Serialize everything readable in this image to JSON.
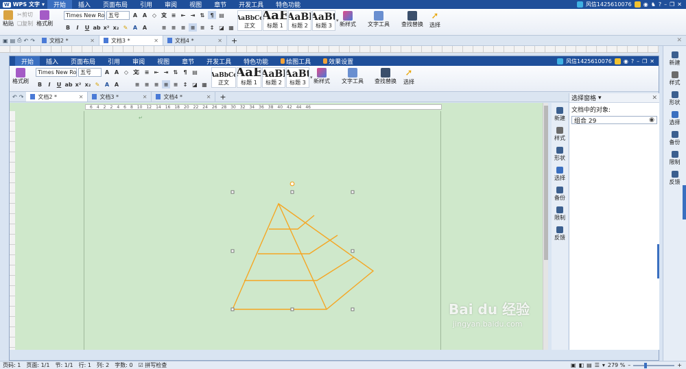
{
  "app_title": "WPS 文字",
  "menus": [
    "开始",
    "插入",
    "页面布局",
    "引用",
    "审阅",
    "视图",
    "章节",
    "开发工具",
    "特色功能"
  ],
  "inner_menus": [
    "开始",
    "插入",
    "页面布局",
    "引用",
    "审阅",
    "视图",
    "章节",
    "开发工具",
    "特色功能",
    "绘图工具",
    "效果设置"
  ],
  "user": "风信1425610076",
  "ribbon": {
    "paste": "粘贴",
    "cut": "剪切",
    "copy": "复制",
    "format_painter": "格式刷",
    "font_name": "Times New Roi",
    "font_size": "五号",
    "styles": [
      {
        "sample": "AaBbCc",
        "label": "正文"
      },
      {
        "sample": "AaE",
        "label": "标题 1"
      },
      {
        "sample": "AaBl",
        "label": "标题 2"
      },
      {
        "sample": "AaBt",
        "label": "标题 3"
      }
    ],
    "new_style": "新样式",
    "text_tools": "文字工具",
    "find_replace": "查找替换",
    "select": "选择"
  },
  "tabs": [
    "文档2 *",
    "文档3 *",
    "文档4 *"
  ],
  "inner_tabs": [
    "文档2 *",
    "文档3 *",
    "文档4 *"
  ],
  "side_buttons": [
    "新建",
    "样式",
    "形状",
    "选择",
    "备份",
    "限制",
    "反馈"
  ],
  "selection_pane": {
    "title": "选择窗格",
    "subtitle": "文档中的对象:",
    "item": "组合 29"
  },
  "ruler_ticks": [
    "6",
    "4",
    "2",
    "2",
    "4",
    "6",
    "8",
    "10",
    "12",
    "14",
    "16",
    "18",
    "20",
    "22",
    "24",
    "26",
    "28",
    "30",
    "32",
    "34",
    "36",
    "38",
    "40",
    "42",
    "44",
    "46"
  ],
  "status": {
    "page_num": "页码: 1",
    "pages": "页面: 1/1",
    "section": "节: 1/1",
    "row": "行: 1",
    "col": "列: 2",
    "words": "字数: 0",
    "spell": "拼写检查",
    "zoom": "279 %"
  },
  "watermark": {
    "brand": "Bai du 经验",
    "url": "jingyan.baidu.com"
  },
  "colors": {
    "shape": "#f5a623",
    "page": "#cfe8cb",
    "menubar": "#1f4f9a"
  }
}
